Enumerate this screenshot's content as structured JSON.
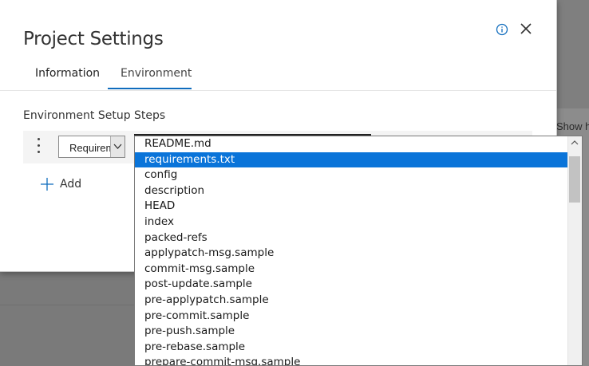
{
  "dialog": {
    "title": "Project Settings",
    "tabs": [
      {
        "label": "Information",
        "active": false
      },
      {
        "label": "Environment",
        "active": true
      }
    ],
    "section_label": "Environment Setup Steps",
    "step": {
      "type_value": "Requirements"
    },
    "add_label": "Add"
  },
  "dropdown": {
    "items": [
      "README.md",
      "requirements.txt",
      "config",
      "description",
      "HEAD",
      "index",
      "packed-refs",
      "applypatch-msg.sample",
      "commit-msg.sample",
      "post-update.sample",
      "pre-applypatch.sample",
      "pre-commit.sample",
      "pre-push.sample",
      "pre-rebase.sample",
      "prepare-commit-msg.sample"
    ],
    "selected": "requirements.txt"
  },
  "background": {
    "show_text": "Show h"
  },
  "colors": {
    "accent": "#0f6cbd",
    "selection": "#0a74d9"
  }
}
